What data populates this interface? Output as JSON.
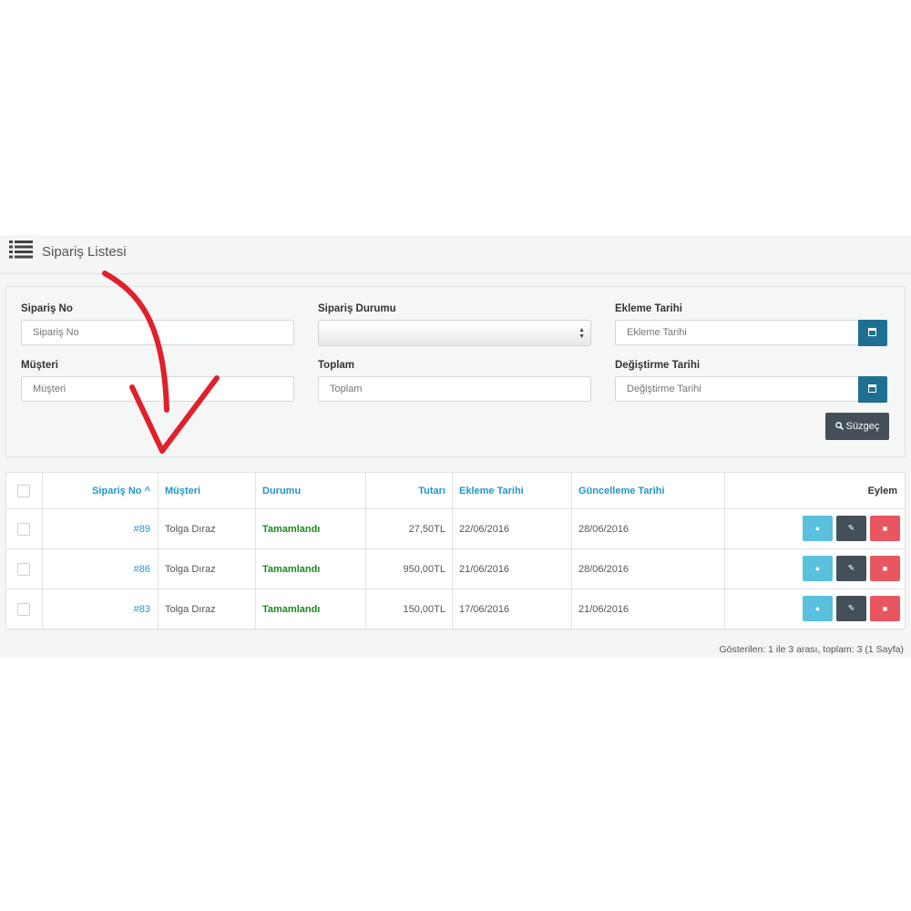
{
  "header": {
    "title": "Sipariş Listesi"
  },
  "filters": {
    "order_no": {
      "label": "Sipariş No",
      "placeholder": "Sipariş No"
    },
    "order_status": {
      "label": "Sipariş Durumu",
      "value": ""
    },
    "added_date": {
      "label": "Ekleme Tarihi",
      "placeholder": "Ekleme Tarihi"
    },
    "customer": {
      "label": "Müşteri",
      "placeholder": "Müşteri"
    },
    "total": {
      "label": "Toplam",
      "placeholder": "Toplam"
    },
    "modified_date": {
      "label": "Değiştirme Tarihi",
      "placeholder": "Değiştirme Tarihi"
    },
    "filter_button": "Süzgeç"
  },
  "table": {
    "columns": {
      "order_no": "Sipariş No",
      "customer": "Müşteri",
      "status": "Durumu",
      "total": "Tutarı",
      "added": "Ekleme Tarihi",
      "updated": "Güncelleme Tarihi",
      "action": "Eylem"
    },
    "rows": [
      {
        "order_no": "#89",
        "customer": "Tolga Dıraz",
        "status": "Tamamlandı",
        "total": "27,50TL",
        "added": "22/06/2016",
        "updated": "28/06/2016"
      },
      {
        "order_no": "#86",
        "customer": "Tolga Dıraz",
        "status": "Tamamlandı",
        "total": "950,00TL",
        "added": "21/06/2016",
        "updated": "28/06/2016"
      },
      {
        "order_no": "#83",
        "customer": "Tolga Dıraz",
        "status": "Tamamlandı",
        "total": "150,00TL",
        "added": "17/06/2016",
        "updated": "21/06/2016"
      }
    ]
  },
  "pagination": {
    "text": "Gösterilen: 1 ile 3 arası, toplam: 3 (1 Sayfa)"
  },
  "colors": {
    "link": "#2197c9",
    "status_complete": "#1a8a1e",
    "view": "#5bc0de",
    "edit": "#454f5a",
    "delete": "#e8575f",
    "calendar": "#1f6f92",
    "arrow": "#e0202a"
  }
}
